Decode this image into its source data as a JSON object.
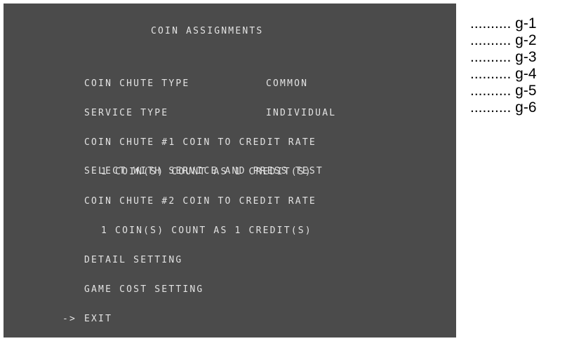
{
  "screen": {
    "title": "COIN ASSIGNMENTS",
    "cursor": "->",
    "menu": [
      {
        "label": "COIN CHUTE TYPE",
        "value": "COMMON"
      },
      {
        "label": "SERVICE TYPE",
        "value": "INDIVIDUAL"
      },
      {
        "label": "COIN CHUTE #1 COIN TO CREDIT RATE",
        "value": ""
      },
      {
        "label": "1 COIN(S) COUNT AS 1 CREDIT(S)",
        "value": ""
      },
      {
        "label": "COIN CHUTE #2 COIN TO CREDIT RATE",
        "value": ""
      },
      {
        "label": "1 COIN(S) COUNT AS 1 CREDIT(S)",
        "value": ""
      },
      {
        "label": "DETAIL SETTING",
        "value": ""
      },
      {
        "label": "GAME COST SETTING",
        "value": ""
      },
      {
        "label": "EXIT",
        "value": ""
      }
    ],
    "instruction": "SELECT WITH SERVICE AND PRESS TEST"
  },
  "annotations": [
    ".......... g-1",
    ".......... g-2",
    ".......... g-3",
    ".......... g-4",
    ".......... g-5",
    ".......... g-6"
  ]
}
